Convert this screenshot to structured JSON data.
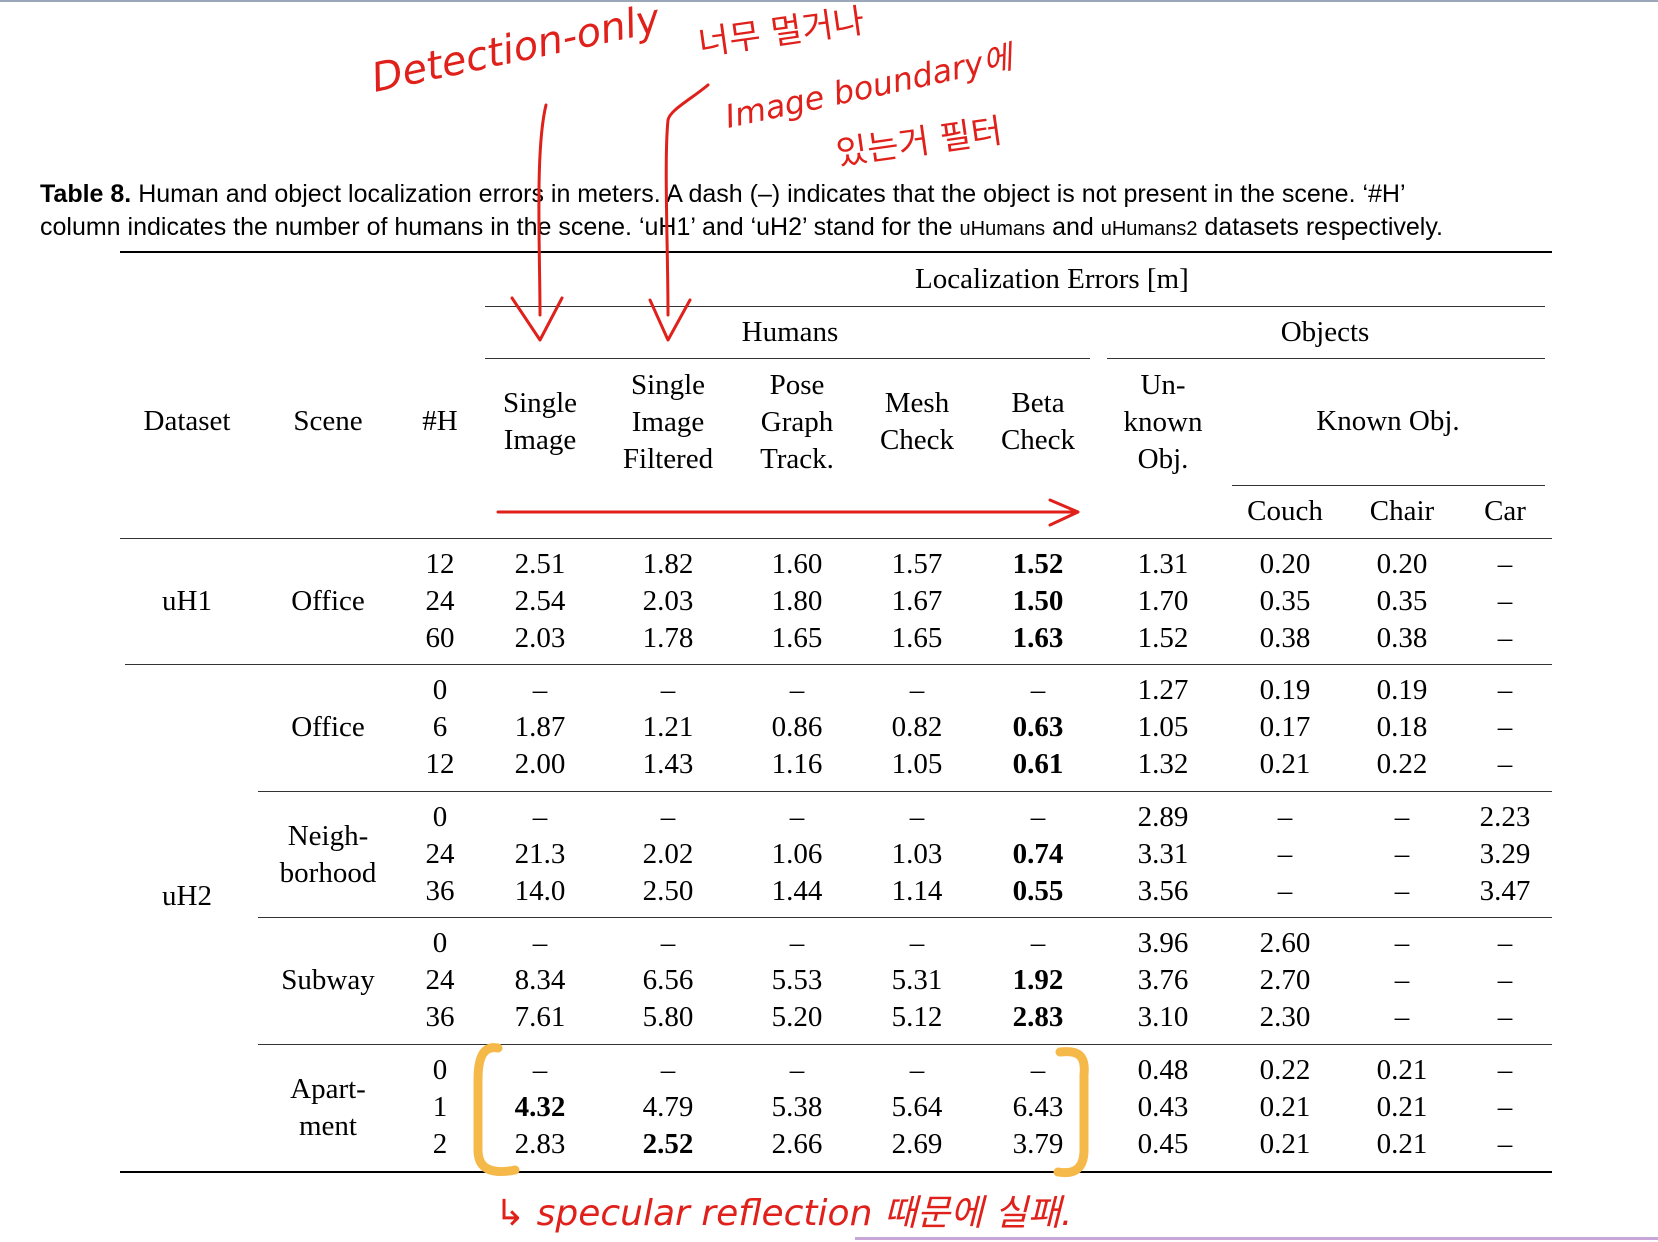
{
  "caption": {
    "label": "Table 8.",
    "text_part1": " Human and object localization errors in meters. A dash (–) indicates that the object is not present in the scene. ‘#H’",
    "text_part2": "column indicates the number of humans in the scene. ‘uH1’ and ‘uH2’ stand for the ",
    "ds1": "uHumans",
    "and": " and ",
    "ds2": "uHumans2",
    "text_part3": " datasets respectively."
  },
  "headers": {
    "localization": "Localization Errors [m]",
    "humans": "Humans",
    "objects": "Objects",
    "dataset": "Dataset",
    "scene": "Scene",
    "numh": "#H",
    "single_image": [
      "Single",
      "Image"
    ],
    "single_image_filtered": [
      "Single",
      "Image",
      "Filtered"
    ],
    "pose_graph": [
      "Pose",
      "Graph",
      "Track."
    ],
    "mesh_check": [
      "Mesh",
      "Check"
    ],
    "beta_check": [
      "Beta",
      "Check"
    ],
    "unknown_obj": [
      "Un-",
      "known",
      "Obj."
    ],
    "known_obj": "Known Obj.",
    "couch": "Couch",
    "chair": "Chair",
    "car": "Car"
  },
  "groups": [
    {
      "dataset": "uH1",
      "scene": [
        "Office"
      ],
      "rows": [
        [
          "12",
          "2.51",
          "1.82",
          "1.60",
          "1.57",
          "1.52",
          "1.31",
          "0.20",
          "0.20",
          "–"
        ],
        [
          "24",
          "2.54",
          "2.03",
          "1.80",
          "1.67",
          "1.50",
          "1.70",
          "0.35",
          "0.35",
          "–"
        ],
        [
          "60",
          "2.03",
          "1.78",
          "1.65",
          "1.65",
          "1.63",
          "1.52",
          "0.38",
          "0.38",
          "–"
        ]
      ],
      "bold": [
        [
          0,
          5
        ],
        [
          1,
          5
        ],
        [
          2,
          5
        ]
      ]
    },
    {
      "dataset": "uH2",
      "scene": [
        "Office"
      ],
      "rows": [
        [
          "0",
          "–",
          "–",
          "–",
          "–",
          "–",
          "1.27",
          "0.19",
          "0.19",
          "–"
        ],
        [
          "6",
          "1.87",
          "1.21",
          "0.86",
          "0.82",
          "0.63",
          "1.05",
          "0.17",
          "0.18",
          "–"
        ],
        [
          "12",
          "2.00",
          "1.43",
          "1.16",
          "1.05",
          "0.61",
          "1.32",
          "0.21",
          "0.22",
          "–"
        ]
      ],
      "bold": [
        [
          1,
          5
        ],
        [
          2,
          5
        ]
      ]
    },
    {
      "dataset": "",
      "scene": [
        "Neigh-",
        "borhood"
      ],
      "rows": [
        [
          "0",
          "–",
          "–",
          "–",
          "–",
          "–",
          "2.89",
          "–",
          "–",
          "2.23"
        ],
        [
          "24",
          "21.3",
          "2.02",
          "1.06",
          "1.03",
          "0.74",
          "3.31",
          "–",
          "–",
          "3.29"
        ],
        [
          "36",
          "14.0",
          "2.50",
          "1.44",
          "1.14",
          "0.55",
          "3.56",
          "–",
          "–",
          "3.47"
        ]
      ],
      "bold": [
        [
          1,
          5
        ],
        [
          2,
          5
        ]
      ]
    },
    {
      "dataset": "",
      "scene": [
        "Subway"
      ],
      "rows": [
        [
          "0",
          "–",
          "–",
          "–",
          "–",
          "–",
          "3.96",
          "2.60",
          "–",
          "–"
        ],
        [
          "24",
          "8.34",
          "6.56",
          "5.53",
          "5.31",
          "1.92",
          "3.76",
          "2.70",
          "–",
          "–"
        ],
        [
          "36",
          "7.61",
          "5.80",
          "5.20",
          "5.12",
          "2.83",
          "3.10",
          "2.30",
          "–",
          "–"
        ]
      ],
      "bold": [
        [
          1,
          5
        ],
        [
          2,
          5
        ]
      ]
    },
    {
      "dataset": "",
      "scene": [
        "Apart-",
        "ment"
      ],
      "rows": [
        [
          "0",
          "–",
          "–",
          "–",
          "–",
          "–",
          "0.48",
          "0.22",
          "0.21",
          "–"
        ],
        [
          "1",
          "4.32",
          "4.79",
          "5.38",
          "5.64",
          "6.43",
          "0.43",
          "0.21",
          "0.21",
          "–"
        ],
        [
          "2",
          "2.83",
          "2.52",
          "2.66",
          "2.69",
          "3.79",
          "0.45",
          "0.21",
          "0.21",
          "–"
        ]
      ],
      "bold": [
        [
          1,
          1
        ],
        [
          2,
          2
        ]
      ]
    }
  ],
  "annotations": {
    "detection_only": "Detection-only",
    "korean_1": "너무 멀거나",
    "korean_2": "Image boundary에",
    "korean_3": "있는거 필터",
    "specular": "↳ specular reflection 때문에 실패.",
    "red": "#e0201a",
    "orange": "#f5b94a"
  }
}
